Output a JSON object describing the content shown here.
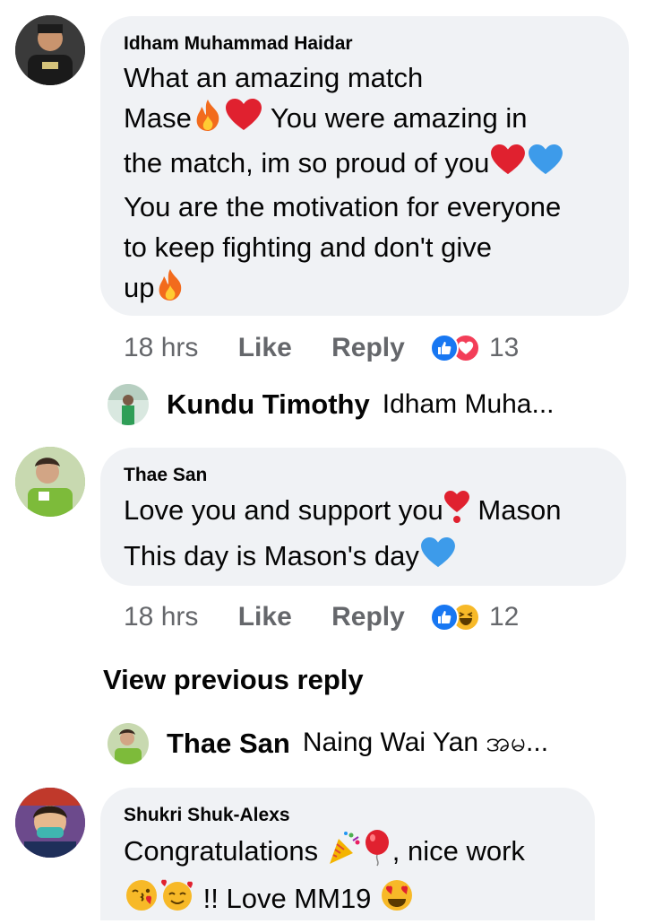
{
  "comments": [
    {
      "author": "Idham Muhammad Haidar",
      "lines": [
        "What an amazing match",
        "Mase",
        "You were amazing in",
        "the match, im so proud of you",
        "You are the motivation for everyone",
        "to keep fighting and don't give",
        "up"
      ],
      "time": "18 hrs",
      "like_label": "Like",
      "reply_label": "Reply",
      "reaction_count": "13",
      "reactions": [
        "like-icon",
        "love-icon"
      ],
      "reply_preview": {
        "name": "Kundu Timothy",
        "snippet": "Idham Muha..."
      }
    },
    {
      "author": "Thae San",
      "lines": [
        "Love you and support you",
        "Mason",
        "This day is Mason's day"
      ],
      "time": "18 hrs",
      "like_label": "Like",
      "reply_label": "Reply",
      "reaction_count": "12",
      "reactions": [
        "like-icon",
        "haha-icon"
      ],
      "view_previous": "View previous reply",
      "reply_preview": {
        "name": "Thae San",
        "snippet": "Naing Wai Yan အမ..."
      }
    },
    {
      "author": "Shukri Shuk-Alexs",
      "lines": [
        "Congratulations",
        ", nice work",
        "!! Love MM19"
      ]
    }
  ],
  "colors": {
    "bubble": "#f0f2f5",
    "meta": "#65676b",
    "like_blue": "#1877f2",
    "love_red": "#f33e58",
    "haha_yellow": "#f7b928"
  }
}
